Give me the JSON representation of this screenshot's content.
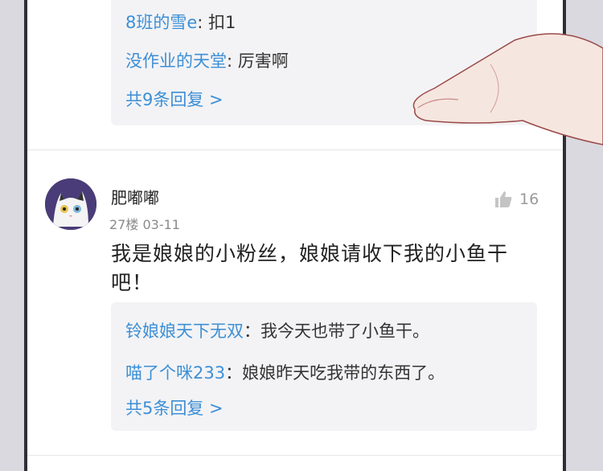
{
  "thread_top": {
    "replies": [
      {
        "user": "8班的雪e",
        "text": ": 扣1"
      },
      {
        "user": "没作业的天堂",
        "text": ": 厉害啊"
      }
    ],
    "more_replies": "共9条回复 >"
  },
  "comment": {
    "username": "肥嘟嘟",
    "floor": "27楼",
    "date": "03-11",
    "likes": "16",
    "text": "我是娘娘的小粉丝，娘娘请收下我的小鱼干吧！",
    "replies": [
      {
        "user": "铃娘娘天下无双",
        "text": "：我今天也带了小鱼干。"
      },
      {
        "user": "喵了个咪233",
        "text": "：娘娘昨天吃我带的东西了。"
      }
    ],
    "more_replies": "共5条回复 >"
  },
  "colors": {
    "link_blue": "#3d8fd6",
    "reply_bg": "#f3f3f5",
    "frame": "#2e2e34"
  },
  "icons": [
    "thumbs-up-icon",
    "cat-avatar"
  ]
}
